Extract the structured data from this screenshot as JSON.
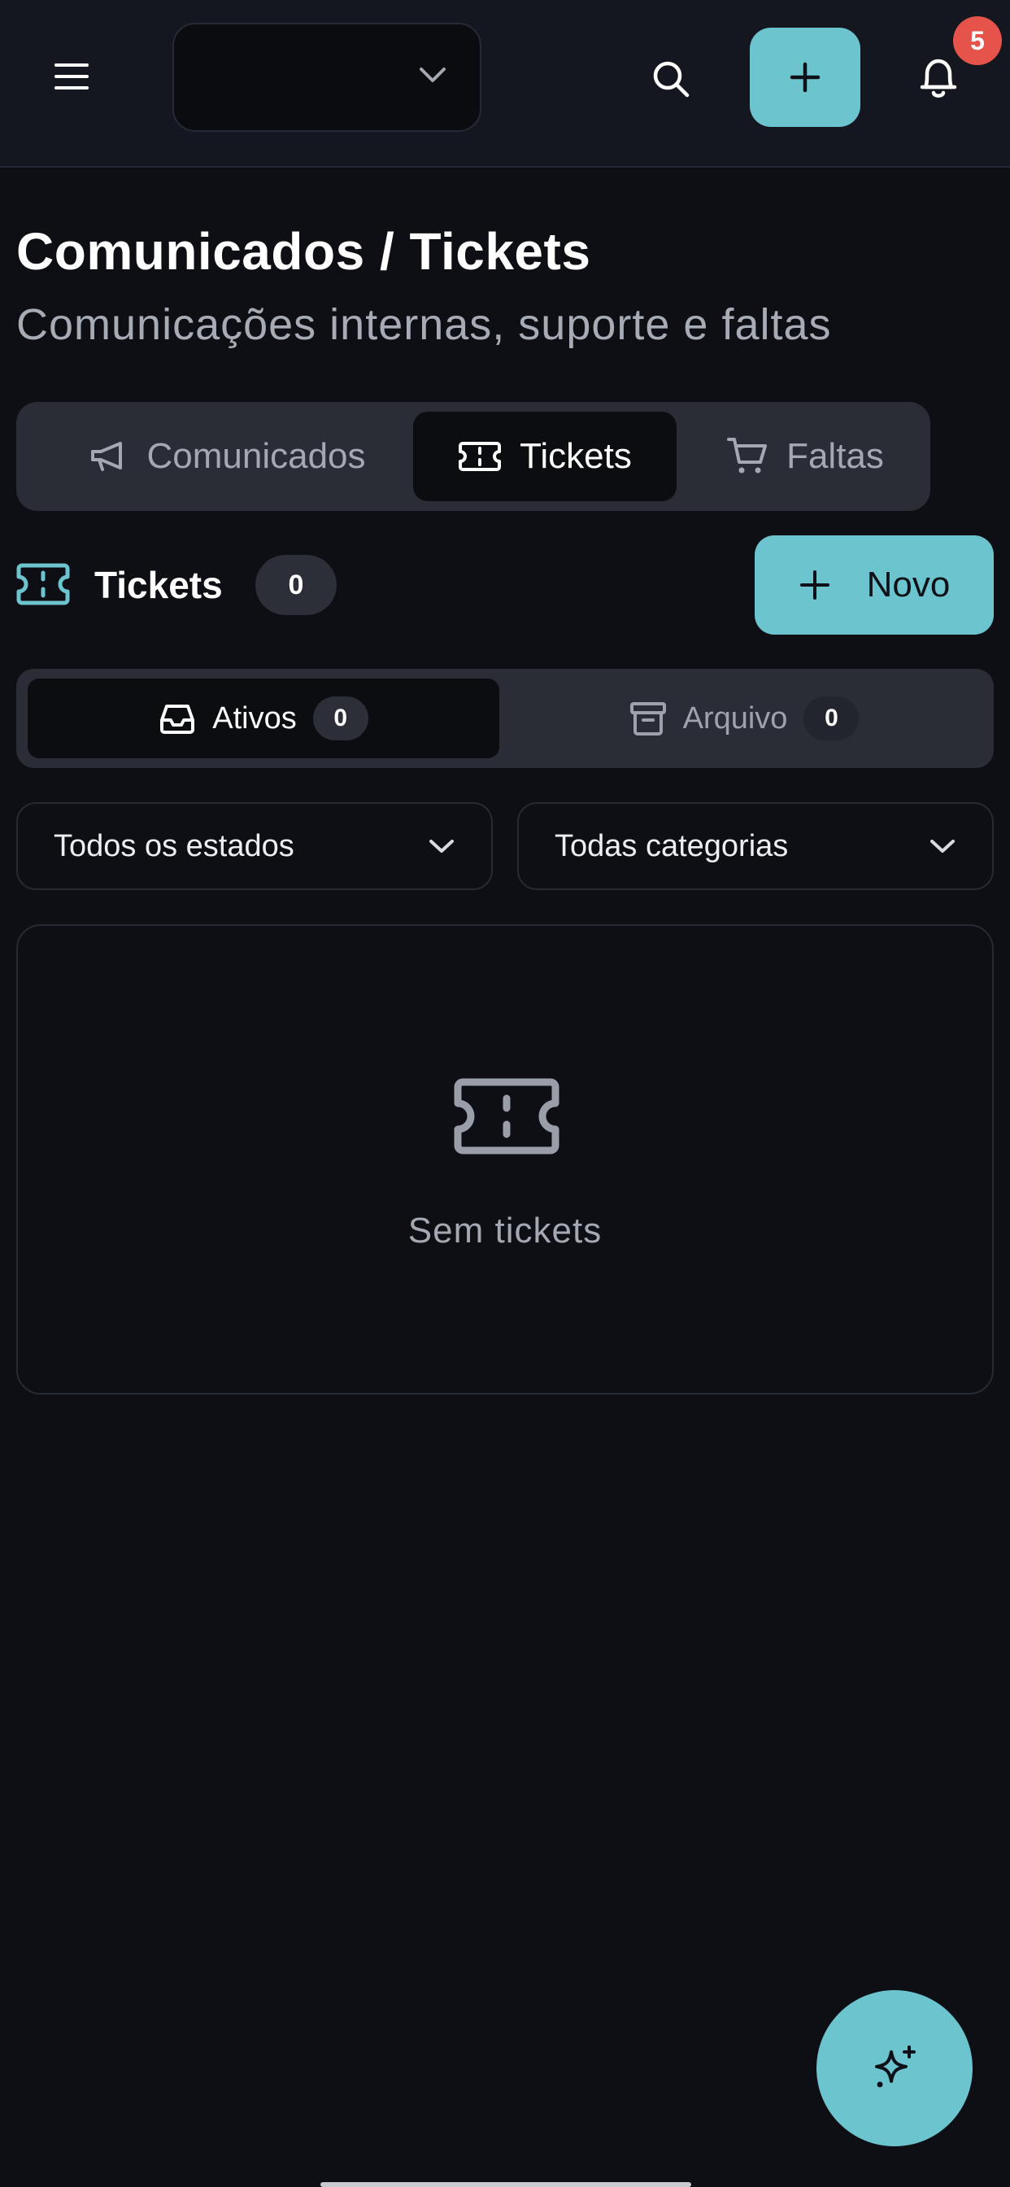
{
  "header": {
    "menu_icon": "hamburger-menu-icon",
    "store_selector_value": "",
    "search_icon": "search-icon",
    "add_icon": "plus-icon",
    "notifications_icon": "bell-icon",
    "notifications_count": "5",
    "accent_color": "#6cc4cf",
    "badge_color": "#e5534b"
  },
  "page": {
    "title": "Comunicados / Tickets",
    "subtitle": "Comunicações internas, suporte e faltas"
  },
  "section_tabs": [
    {
      "label": "Comunicados",
      "icon": "megaphone-icon",
      "active": false
    },
    {
      "label": "Tickets",
      "icon": "ticket-icon",
      "active": true
    },
    {
      "label": "Faltas",
      "icon": "cart-icon",
      "active": false
    }
  ],
  "tickets": {
    "label": "Tickets",
    "count": "0",
    "new_button_label": "Novo"
  },
  "view_toggle": {
    "active_label": "Ativos",
    "active_count": "0",
    "archive_label": "Arquivo",
    "archive_count": "0"
  },
  "filters": {
    "state_value": "Todos os estados",
    "category_value": "Todas categorias"
  },
  "empty_state": {
    "icon": "ticket-icon",
    "text": "Sem tickets"
  },
  "fab": {
    "icon": "sparkles-icon"
  }
}
